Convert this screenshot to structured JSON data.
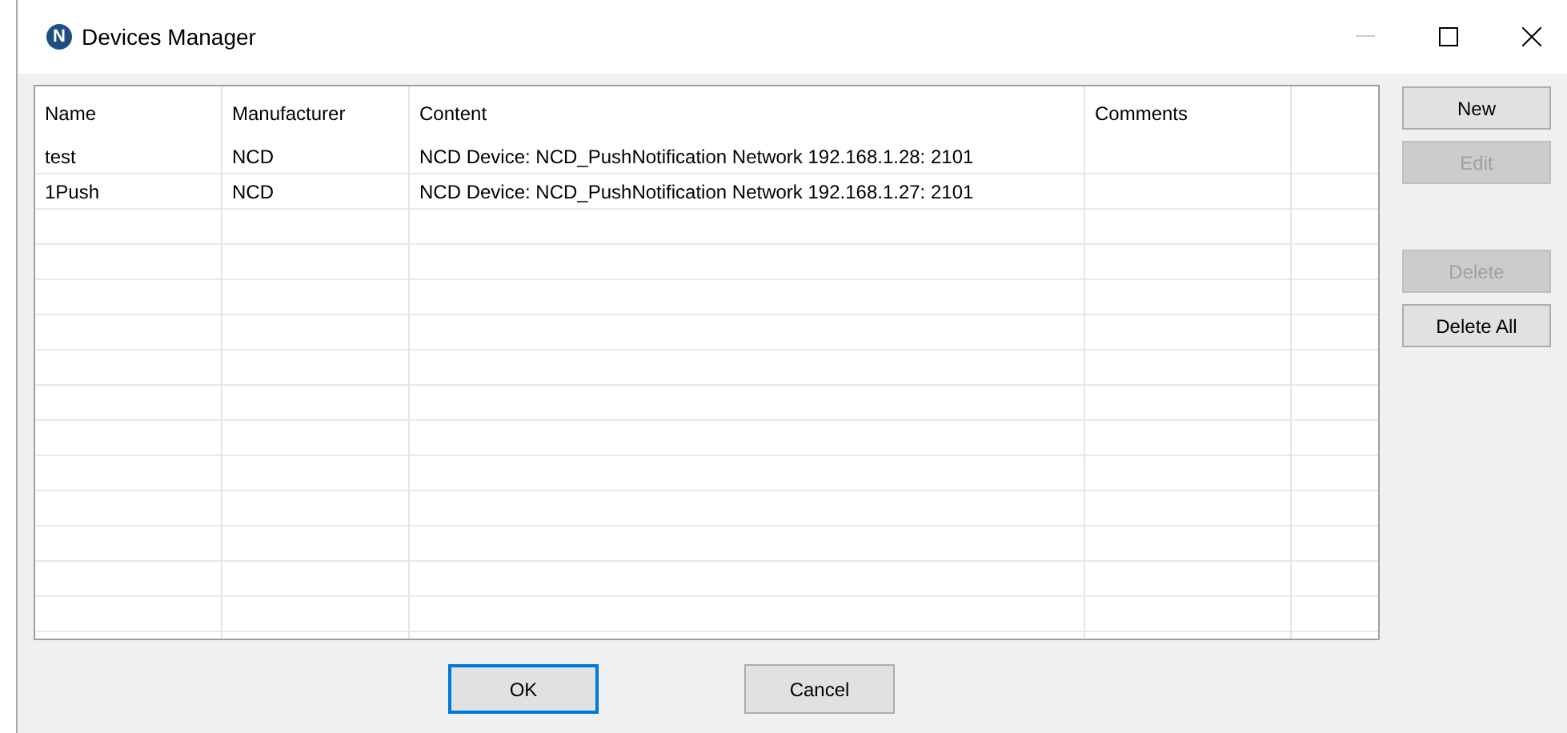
{
  "window": {
    "title": "Devices Manager",
    "icon": "N"
  },
  "table": {
    "columns": [
      "Name",
      "Manufacturer",
      "Content",
      "Comments"
    ],
    "rows": [
      {
        "name": "test",
        "manufacturer": "NCD",
        "content": "NCD Device: NCD_PushNotification  Network  192.168.1.28: 2101"
      },
      {
        "name": "1Push",
        "manufacturer": "NCD",
        "content": "NCD Device: NCD_PushNotification  Network  192.168.1.27: 2101"
      }
    ]
  },
  "side_button_groups": [
    [
      {
        "label": "New",
        "disabled": false
      },
      {
        "label": "Edit",
        "disabled": true
      }
    ],
    [
      {
        "label": "Delete",
        "disabled": true
      },
      {
        "label": "Delete All",
        "disabled": false
      }
    ]
  ],
  "footer_buttons": [
    {
      "label": "OK",
      "focused": true
    },
    {
      "label": "Cancel",
      "focused": false
    }
  ]
}
